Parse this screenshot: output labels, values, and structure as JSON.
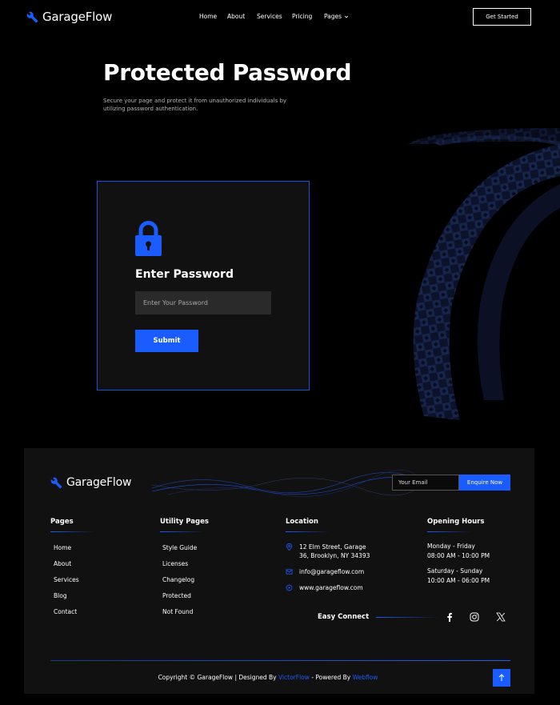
{
  "brand": {
    "name": "GarageFlow",
    "accent": "#1a5cff"
  },
  "nav": {
    "items": [
      "Home",
      "About",
      "Services",
      "Pricing",
      "Pages"
    ],
    "cta": "Get Started"
  },
  "hero": {
    "title": "Protected Password",
    "subtitle": "Secure your page and protect it from unauthorized individuals by utilizing password authentication."
  },
  "form": {
    "title": "Enter Password",
    "placeholder": "Enter Your Password",
    "submit": "Submit"
  },
  "footer": {
    "email_placeholder": "Your Email",
    "enquire": "Enquire Now",
    "pages": {
      "title": "Pages",
      "items": [
        "Home",
        "About",
        "Services",
        "Blog",
        "Contact"
      ]
    },
    "utility": {
      "title": "Utility Pages",
      "items": [
        "Style Guide",
        "Licenses",
        "Changelog",
        "Protected",
        "Not Found"
      ]
    },
    "location": {
      "title": "Location",
      "address_line1": "12 Elm Street, Garage",
      "address_line2": "36, Brooklyn, NY 34393",
      "email": "info@garageflow.com",
      "website": "www.garageflow.com"
    },
    "hours": {
      "title": "Opening Hours",
      "weekday_label": "Monday - Friday",
      "weekday_time": "08:00 AM - 10:00 PM",
      "weekend_label": "Saturday - Sunday",
      "weekend_time": "10:00 AM - 06:00 PM"
    },
    "easy_connect": "Easy Connect",
    "copyright_prefix": "Copyright © GarageFlow | Designed By ",
    "designer": "VictorFlow",
    "powered_prefix": " - Powered By ",
    "powered": "Webflow"
  }
}
